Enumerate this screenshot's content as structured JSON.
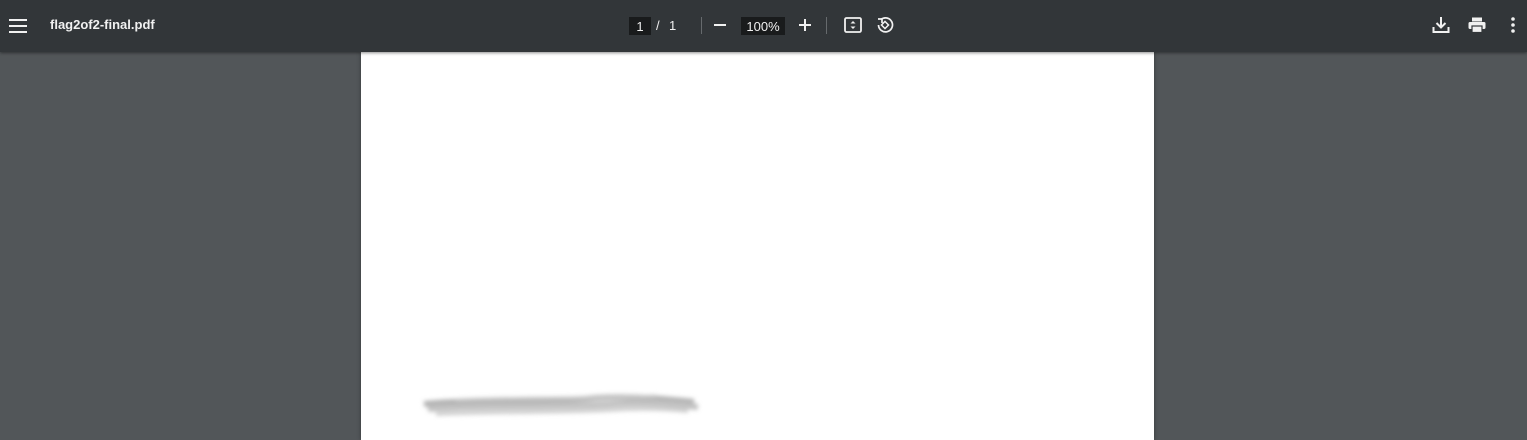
{
  "toolbar": {
    "menu_icon": "hamburger-menu-icon",
    "file_name": "flag2of2-final.pdf",
    "page_current": "1",
    "page_separator": "/",
    "page_total": "1",
    "zoom_value": "100%",
    "icons": {
      "zoom_out": "minus-icon",
      "zoom_in": "plus-icon",
      "fit_page": "fit-to-page-icon",
      "rotate": "rotate-counterclockwise-icon",
      "download": "download-icon",
      "print": "print-icon",
      "more": "more-vertical-icon"
    }
  },
  "colors": {
    "toolbar_bg": "#323639",
    "viewer_bg": "#525659",
    "page_bg": "#ffffff",
    "input_bg": "#191b1c",
    "text": "#f1f1f1"
  }
}
